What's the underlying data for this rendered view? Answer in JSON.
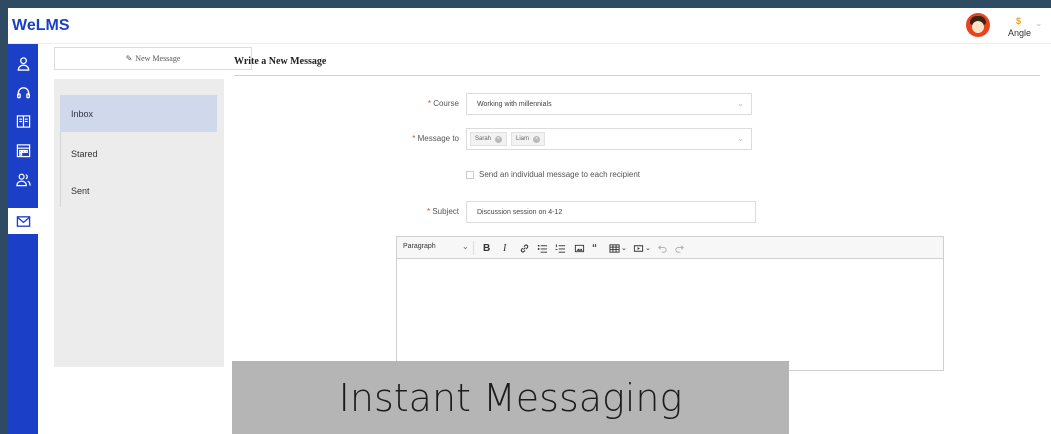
{
  "app": {
    "logo": "WeLMS"
  },
  "user": {
    "dollar": "$",
    "name": "Angle",
    "avatar_icon": "user-avatar-icon"
  },
  "navbar": {
    "items": [
      {
        "icon": "user-icon"
      },
      {
        "icon": "headphones-icon"
      },
      {
        "icon": "book-icon"
      },
      {
        "icon": "calendar-icon"
      },
      {
        "icon": "group-icon"
      },
      {
        "icon": "mail-icon",
        "active": true
      }
    ],
    "bg_color": "#1c3fc7"
  },
  "sidebar": {
    "new_message_label": "New Message",
    "folders": [
      {
        "label": "Inbox",
        "active": true
      },
      {
        "label": "Stared"
      },
      {
        "label": "Sent"
      }
    ]
  },
  "form": {
    "title": "Write a New Message",
    "course_label": "Course",
    "course_value": "Working with millennials",
    "message_to_label": "Message to",
    "recipients": [
      "Sarah",
      "Liam"
    ],
    "individual_label": "Send an individual message to each recipient",
    "subject_label": "Subject",
    "subject_value": "Discussion session on 4-12",
    "required_mark": "*"
  },
  "editor": {
    "block_format": "Paragraph",
    "tools": [
      "bold",
      "italic",
      "link",
      "bulleted-list",
      "numbered-list",
      "image",
      "block-quote",
      "table",
      "media",
      "undo",
      "redo"
    ]
  },
  "caption": "Instant Messaging"
}
